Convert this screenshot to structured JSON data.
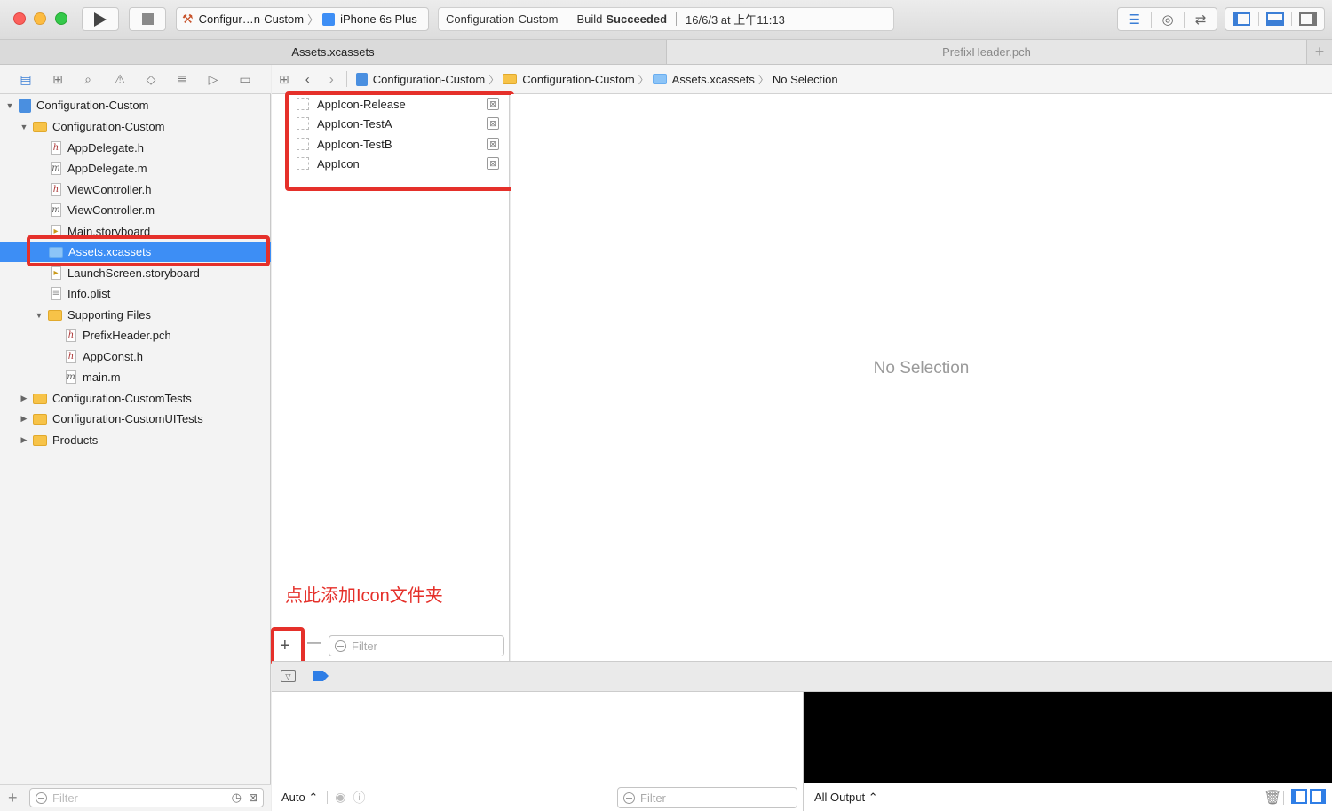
{
  "toolbar": {
    "scheme": "Configur…n-Custom",
    "device": "iPhone 6s Plus",
    "status_project": "Configuration-Custom",
    "status_build_prefix": "Build",
    "status_build_result": "Succeeded",
    "status_time": "16/6/3 at 上午11:13"
  },
  "tabs": [
    {
      "label": "Assets.xcassets",
      "active": true
    },
    {
      "label": "PrefixHeader.pch",
      "active": false
    }
  ],
  "jumpbar": {
    "crumbs": [
      "Configuration-Custom",
      "Configuration-Custom",
      "Assets.xcassets",
      "No Selection"
    ]
  },
  "navigator": {
    "items": [
      {
        "label": "Configuration-Custom",
        "type": "project",
        "disclosure": "▼"
      },
      {
        "label": "Configuration-Custom",
        "type": "folder",
        "disclosure": "▼"
      },
      {
        "label": "AppDelegate.h",
        "type": "h"
      },
      {
        "label": "AppDelegate.m",
        "type": "m"
      },
      {
        "label": "ViewController.h",
        "type": "h"
      },
      {
        "label": "ViewController.m",
        "type": "m"
      },
      {
        "label": "Main.storyboard",
        "type": "storyboard"
      },
      {
        "label": "Assets.xcassets",
        "type": "assets",
        "selected": true
      },
      {
        "label": "LaunchScreen.storyboard",
        "type": "storyboard"
      },
      {
        "label": "Info.plist",
        "type": "plist"
      },
      {
        "label": "Supporting Files",
        "type": "folder",
        "disclosure": "▼"
      },
      {
        "label": "PrefixHeader.pch",
        "type": "h"
      },
      {
        "label": "AppConst.h",
        "type": "h"
      },
      {
        "label": "main.m",
        "type": "m"
      },
      {
        "label": "Configuration-CustomTests",
        "type": "folder",
        "disclosure": "▶"
      },
      {
        "label": "Configuration-CustomUITests",
        "type": "folder",
        "disclosure": "▶"
      },
      {
        "label": "Products",
        "type": "folder",
        "disclosure": "▶"
      }
    ],
    "filter_placeholder": "Filter"
  },
  "assets": {
    "items": [
      "AppIcon-Release",
      "AppIcon-TestA",
      "AppIcon-TestB",
      "AppIcon"
    ],
    "filter_placeholder": "Filter",
    "annotation": "点此添加Icon文件夹"
  },
  "editor": {
    "empty_text": "No Selection"
  },
  "debug": {
    "auto_label": "Auto ⌃",
    "filter_placeholder": "Filter",
    "output_label": "All Output ⌃"
  },
  "colors": {
    "highlight": "#e5302a",
    "selection": "#3d8ef5"
  }
}
